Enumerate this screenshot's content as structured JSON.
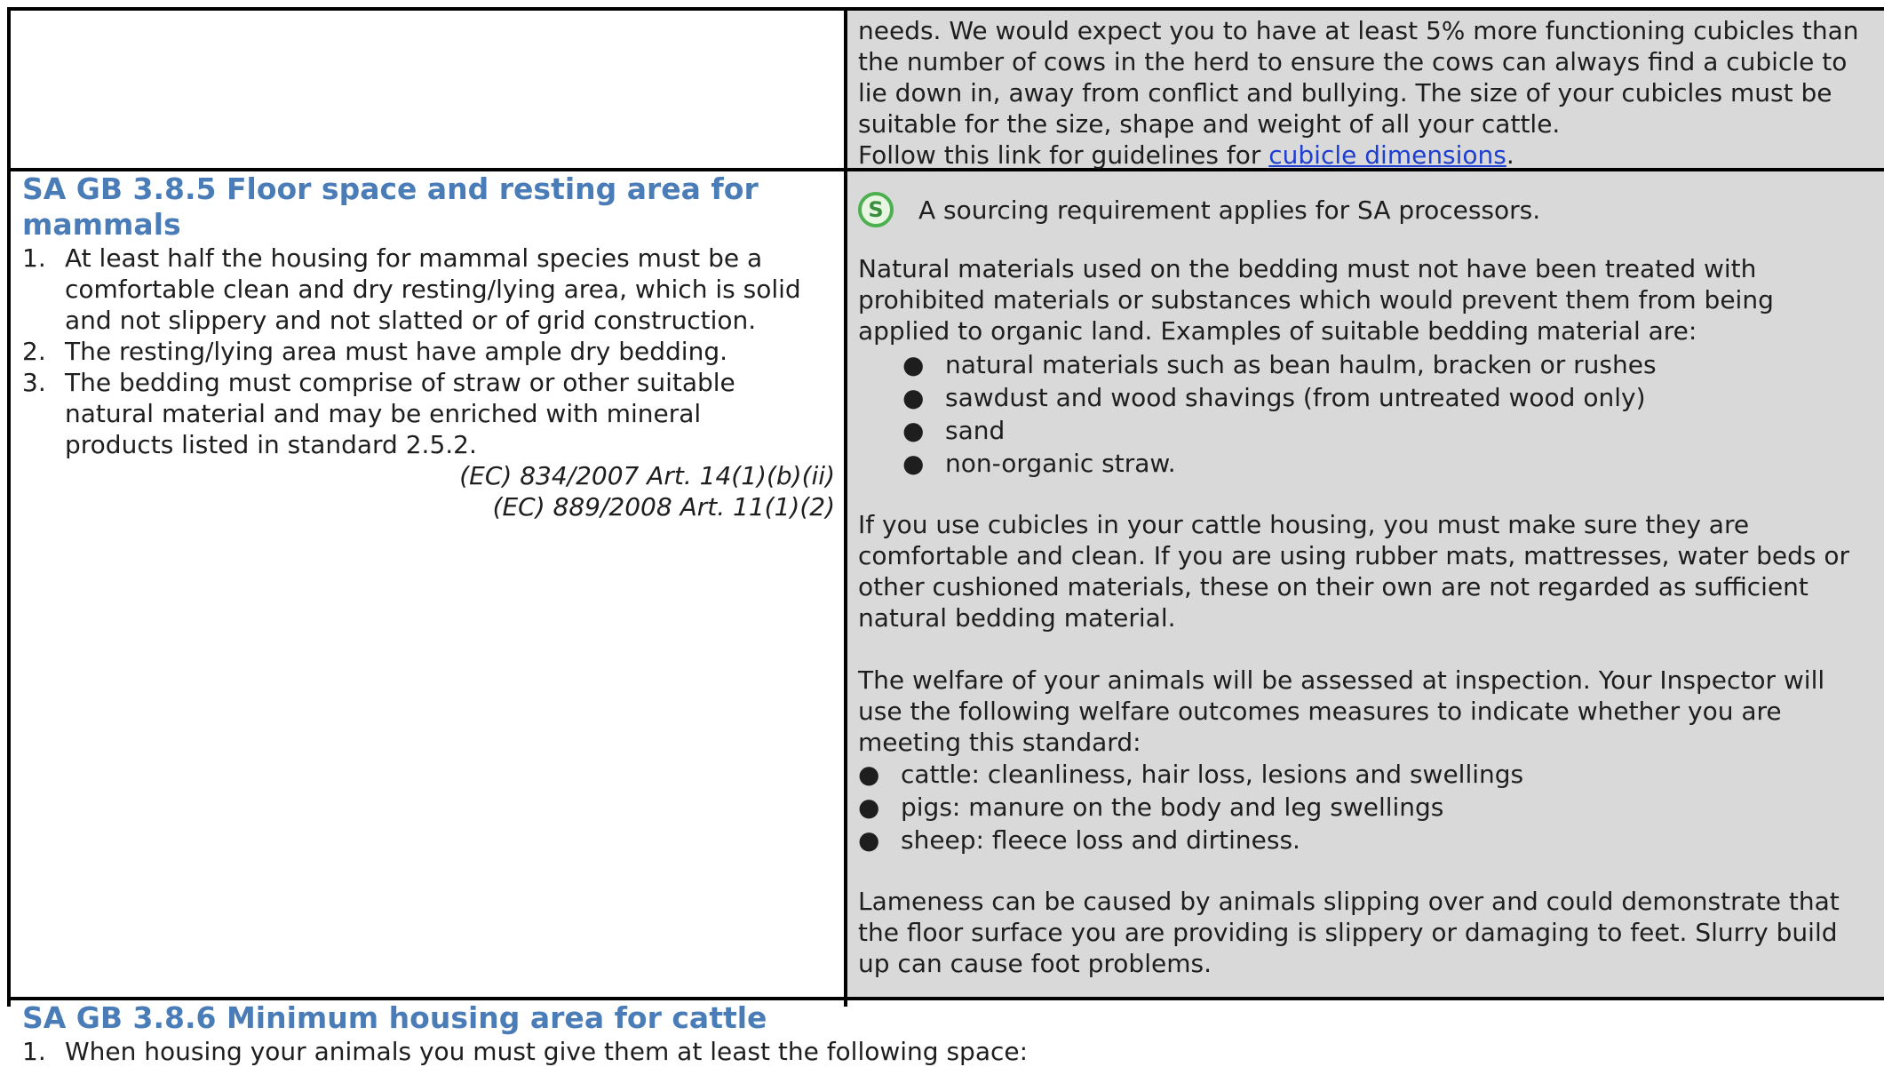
{
  "top_right": {
    "line1": "needs. We would expect you to have at least 5% more functioning cubicles than",
    "line2": "the number of cows in the herd to ensure the cows can always find a cubicle to",
    "line3": "lie down in, away from conflict and bullying. The size of your cubicles must be",
    "line4": "suitable for the size, shape and weight of all your cattle.",
    "link_prefix": "Follow this link for guidelines for ",
    "link_text": "cubicle dimensions",
    "link_suffix": "."
  },
  "standard_385": {
    "heading": "SA GB 3.8.5 Floor space and resting area for mammals",
    "items": [
      {
        "num": "1.",
        "lines": [
          "At least half the housing for mammal species must be a",
          "comfortable clean and dry resting/lying area, which is solid",
          "and not slippery and not slatted or of grid construction."
        ]
      },
      {
        "num": "2.",
        "lines": [
          "The resting/lying area must have ample dry bedding."
        ]
      },
      {
        "num": "3.",
        "lines": [
          "The bedding must comprise of straw or other suitable",
          "natural material and may be enriched with mineral",
          "products listed in standard 2.5.2."
        ]
      }
    ],
    "refs": [
      "(EC) 834/2007 Art. 14(1)(b)(ii)",
      "(EC) 889/2008 Art. 11(1)(2)"
    ]
  },
  "guidance_385": {
    "badge_letter": "S",
    "badge_text": "A sourcing requirement applies for SA processors.",
    "para1": [
      "Natural materials used on the bedding must not have been treated with",
      "prohibited materials or substances which would prevent them from being",
      "applied to organic land. Examples of suitable bedding material are:"
    ],
    "bedding": [
      "natural materials such as bean haulm, bracken or rushes",
      "sawdust and wood shavings (from untreated wood only)",
      "sand",
      "non-organic straw."
    ],
    "para2": [
      "If you use cubicles in your cattle housing, you must make sure they are",
      "comfortable and clean. If you are using rubber mats, mattresses, water beds or",
      "other cushioned materials, these on their own are not regarded as sufficient",
      "natural bedding material."
    ],
    "para3": [
      "The welfare of your animals will be assessed at inspection. Your Inspector will",
      "use the following welfare outcomes measures to indicate whether you are",
      "meeting this standard:"
    ],
    "welfare": [
      "cattle: cleanliness, hair loss, lesions and swellings",
      "pigs: manure on the body and leg swellings",
      "sheep: fleece loss and dirtiness."
    ],
    "para4": [
      "Lameness can be caused by animals slipping over and could demonstrate that",
      "the floor surface you are providing is slippery or damaging to feet. Slurry build",
      "up can cause foot problems."
    ]
  },
  "standard_386": {
    "heading": "SA GB 3.8.6 Minimum housing area for cattle",
    "item1_num": "1.",
    "item1": "When housing your animals you must give them at least the following space:"
  },
  "colors": {
    "heading": "#4a7db8",
    "guidance_bg": "#d9d9d9",
    "link": "#1f3fd0",
    "badge": "#4caf50"
  },
  "icons": {
    "badge": "sourcing-requirement-s-icon",
    "bullet": "bullet-dot-icon"
  }
}
